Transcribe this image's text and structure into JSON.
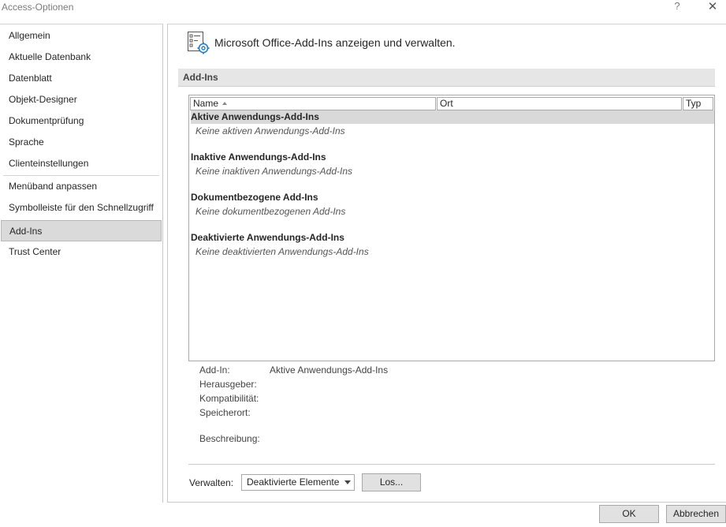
{
  "window": {
    "title": "Access-Optionen",
    "help_glyph": "?",
    "close_glyph": "✕"
  },
  "sidebar": {
    "items": [
      {
        "label": "Allgemein"
      },
      {
        "label": "Aktuelle Datenbank"
      },
      {
        "label": "Datenblatt"
      },
      {
        "label": "Objekt-Designer"
      },
      {
        "label": "Dokumentprüfung"
      },
      {
        "label": "Sprache"
      },
      {
        "label": "Clienteinstellungen"
      },
      {
        "label": "Menüband anpassen"
      },
      {
        "label": "Symbolleiste für den Schnellzugriff"
      },
      {
        "label": "Add-Ins",
        "selected": true
      },
      {
        "label": "Trust Center"
      }
    ]
  },
  "main": {
    "header_icon": "addins-gear-icon",
    "header_text": "Microsoft Office-Add-Ins anzeigen und verwalten.",
    "section_title": "Add-Ins",
    "columns": {
      "name": "Name",
      "ort": "Ort",
      "typ": "Typ"
    },
    "groups": [
      {
        "title": "Aktive Anwendungs-Add-Ins",
        "empty_text": "Keine aktiven Anwendungs-Add-Ins",
        "selected": true
      },
      {
        "title": "Inaktive Anwendungs-Add-Ins",
        "empty_text": "Keine inaktiven Anwendungs-Add-Ins"
      },
      {
        "title": "Dokumentbezogene Add-Ins",
        "empty_text": "Keine dokumentbezogenen Add-Ins"
      },
      {
        "title": "Deaktivierte Anwendungs-Add-Ins",
        "empty_text": "Keine deaktivierten Anwendungs-Add-Ins"
      }
    ],
    "details": {
      "addin_label": "Add-In:",
      "addin_value": "Aktive Anwendungs-Add-Ins",
      "publisher_label": "Herausgeber:",
      "compat_label": "Kompatibilität:",
      "location_label": "Speicherort:",
      "description_label": "Beschreibung:"
    },
    "manage": {
      "label": "Verwalten:",
      "selected": "Deaktivierte Elemente",
      "go_label": "Los..."
    }
  },
  "footer": {
    "ok_label": "OK",
    "cancel_label": "Abbrechen"
  },
  "colors": {
    "selected_nav_bg": "#dadada",
    "section_bar_bg": "#e6e6e6",
    "button_bg": "#e1e1e1"
  }
}
